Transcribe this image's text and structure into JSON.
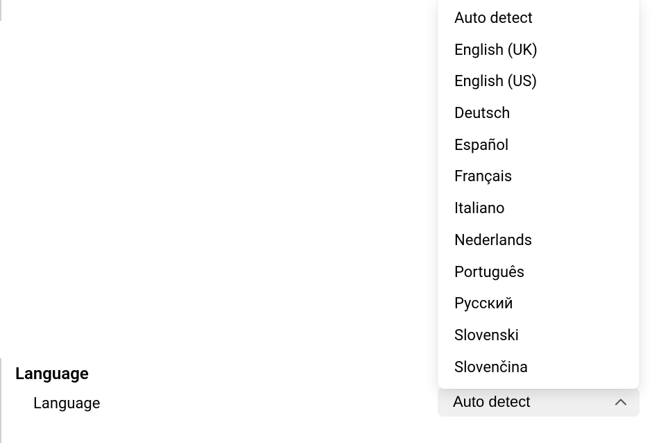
{
  "section": {
    "heading": "Language",
    "label": "Language"
  },
  "dropdown": {
    "selected": "Auto detect",
    "options": [
      "Auto detect",
      "English (UK)",
      "English (US)",
      "Deutsch",
      "Español",
      "Français",
      "Italiano",
      "Nederlands",
      "Português",
      "Русский",
      "Slovenski",
      "Slovenčina"
    ]
  }
}
